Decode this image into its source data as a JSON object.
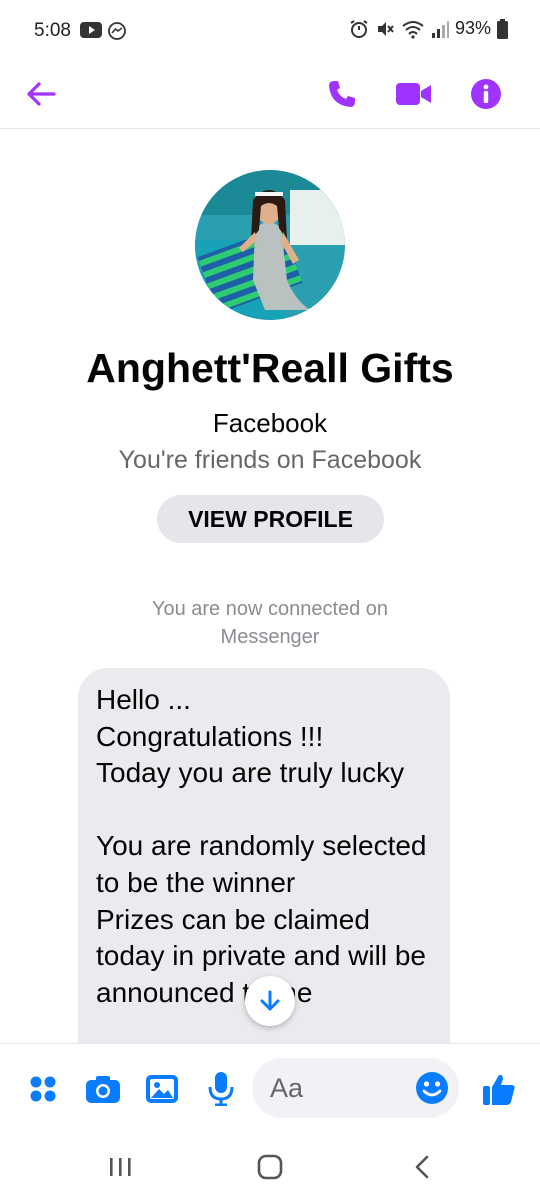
{
  "status_bar": {
    "time": "5:08",
    "battery": "93%",
    "left_icons": [
      "youtube-icon",
      "messenger-icon"
    ],
    "right_icons": [
      "alarm-icon",
      "mute-icon",
      "wifi-icon",
      "signal-icon",
      "battery-icon"
    ]
  },
  "header": {
    "icons": [
      "back-arrow-icon",
      "phone-icon",
      "video-call-icon",
      "info-icon"
    ],
    "accent_color": "#a033ff"
  },
  "profile": {
    "name": "Anghett'Reall Gifts",
    "subtitle": "Facebook",
    "friends_text": "You're friends on Facebook",
    "view_profile_label": "VIEW PROFILE"
  },
  "conversation": {
    "system_message": "You are now connected on Messenger",
    "incoming_message": "Hello ...\nCongratulations !!!\nToday you are truly lucky\n\nYou are randomly selected to be the winner\nPrizes can be claimed today in private and will be announced to the"
  },
  "composer": {
    "placeholder": "Aa",
    "icons": [
      "menu-dots-icon",
      "camera-icon",
      "gallery-icon",
      "microphone-icon",
      "emoji-icon",
      "thumbs-up-icon"
    ],
    "accent_color": "#0a7cff"
  },
  "nav_bar": {
    "icons": [
      "recent-apps-icon",
      "home-icon",
      "back-icon"
    ]
  }
}
